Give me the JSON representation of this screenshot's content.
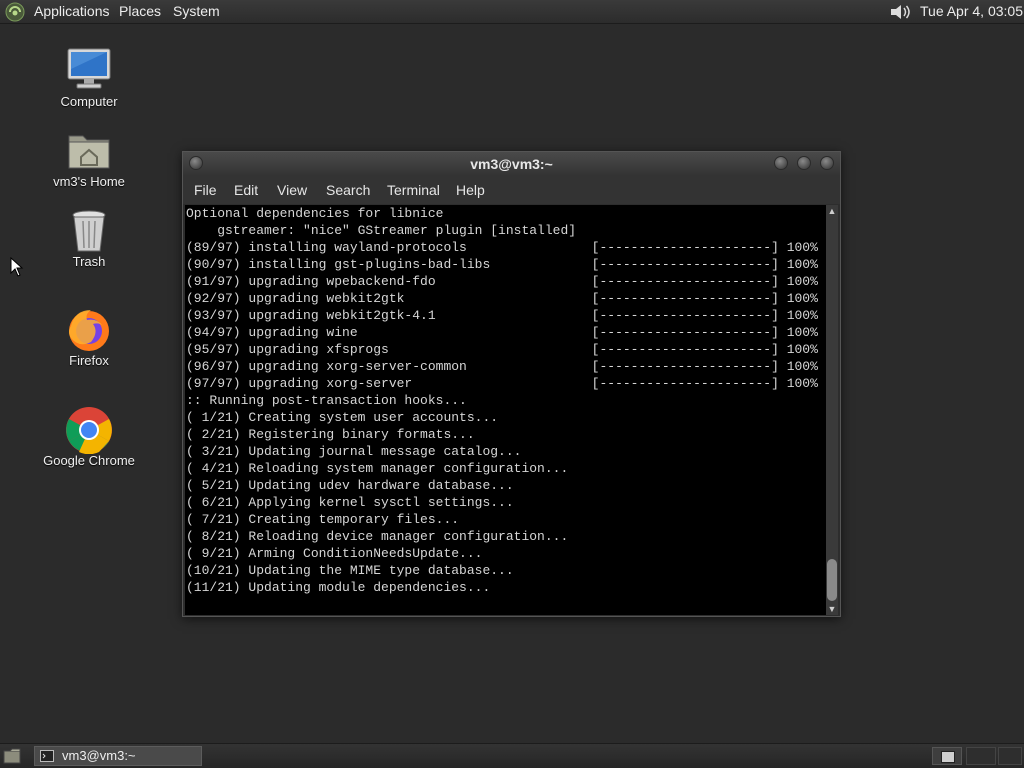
{
  "top_panel": {
    "menus": [
      "Applications",
      "Places",
      "System"
    ],
    "clock": "Tue Apr  4, 03:05"
  },
  "desktop_icons": [
    {
      "label": "Computer",
      "icon": "computer-icon"
    },
    {
      "label": "vm3's Home",
      "icon": "home-folder-icon"
    },
    {
      "label": "Trash",
      "icon": "trash-icon"
    },
    {
      "label": "Firefox",
      "icon": "firefox-icon"
    },
    {
      "label": "Google Chrome",
      "icon": "chrome-icon"
    }
  ],
  "terminal": {
    "title": "vm3@vm3:~",
    "menu": [
      "File",
      "Edit",
      "View",
      "Search",
      "Terminal",
      "Help"
    ],
    "lines": [
      "Optional dependencies for libnice",
      "    gstreamer: \"nice\" GStreamer plugin [installed]",
      "(89/97) installing wayland-protocols                [----------------------] 100%",
      "(90/97) installing gst-plugins-bad-libs             [----------------------] 100%",
      "(91/97) upgrading wpebackend-fdo                    [----------------------] 100%",
      "(92/97) upgrading webkit2gtk                        [----------------------] 100%",
      "(93/97) upgrading webkit2gtk-4.1                    [----------------------] 100%",
      "(94/97) upgrading wine                              [----------------------] 100%",
      "(95/97) upgrading xfsprogs                          [----------------------] 100%",
      "(96/97) upgrading xorg-server-common                [----------------------] 100%",
      "(97/97) upgrading xorg-server                       [----------------------] 100%",
      ":: Running post-transaction hooks...",
      "( 1/21) Creating system user accounts...",
      "( 2/21) Registering binary formats...",
      "( 3/21) Updating journal message catalog...",
      "( 4/21) Reloading system manager configuration...",
      "( 5/21) Updating udev hardware database...",
      "( 6/21) Applying kernel sysctl settings...",
      "( 7/21) Creating temporary files...",
      "( 8/21) Reloading device manager configuration...",
      "( 9/21) Arming ConditionNeedsUpdate...",
      "(10/21) Updating the MIME type database...",
      "(11/21) Updating module dependencies..."
    ]
  },
  "taskbar": {
    "window_label": "vm3@vm3:~"
  },
  "colors": {
    "desktop_bg": "#2b2b2b",
    "terminal_bg": "#000000",
    "terminal_fg": "#d6d6d6"
  }
}
